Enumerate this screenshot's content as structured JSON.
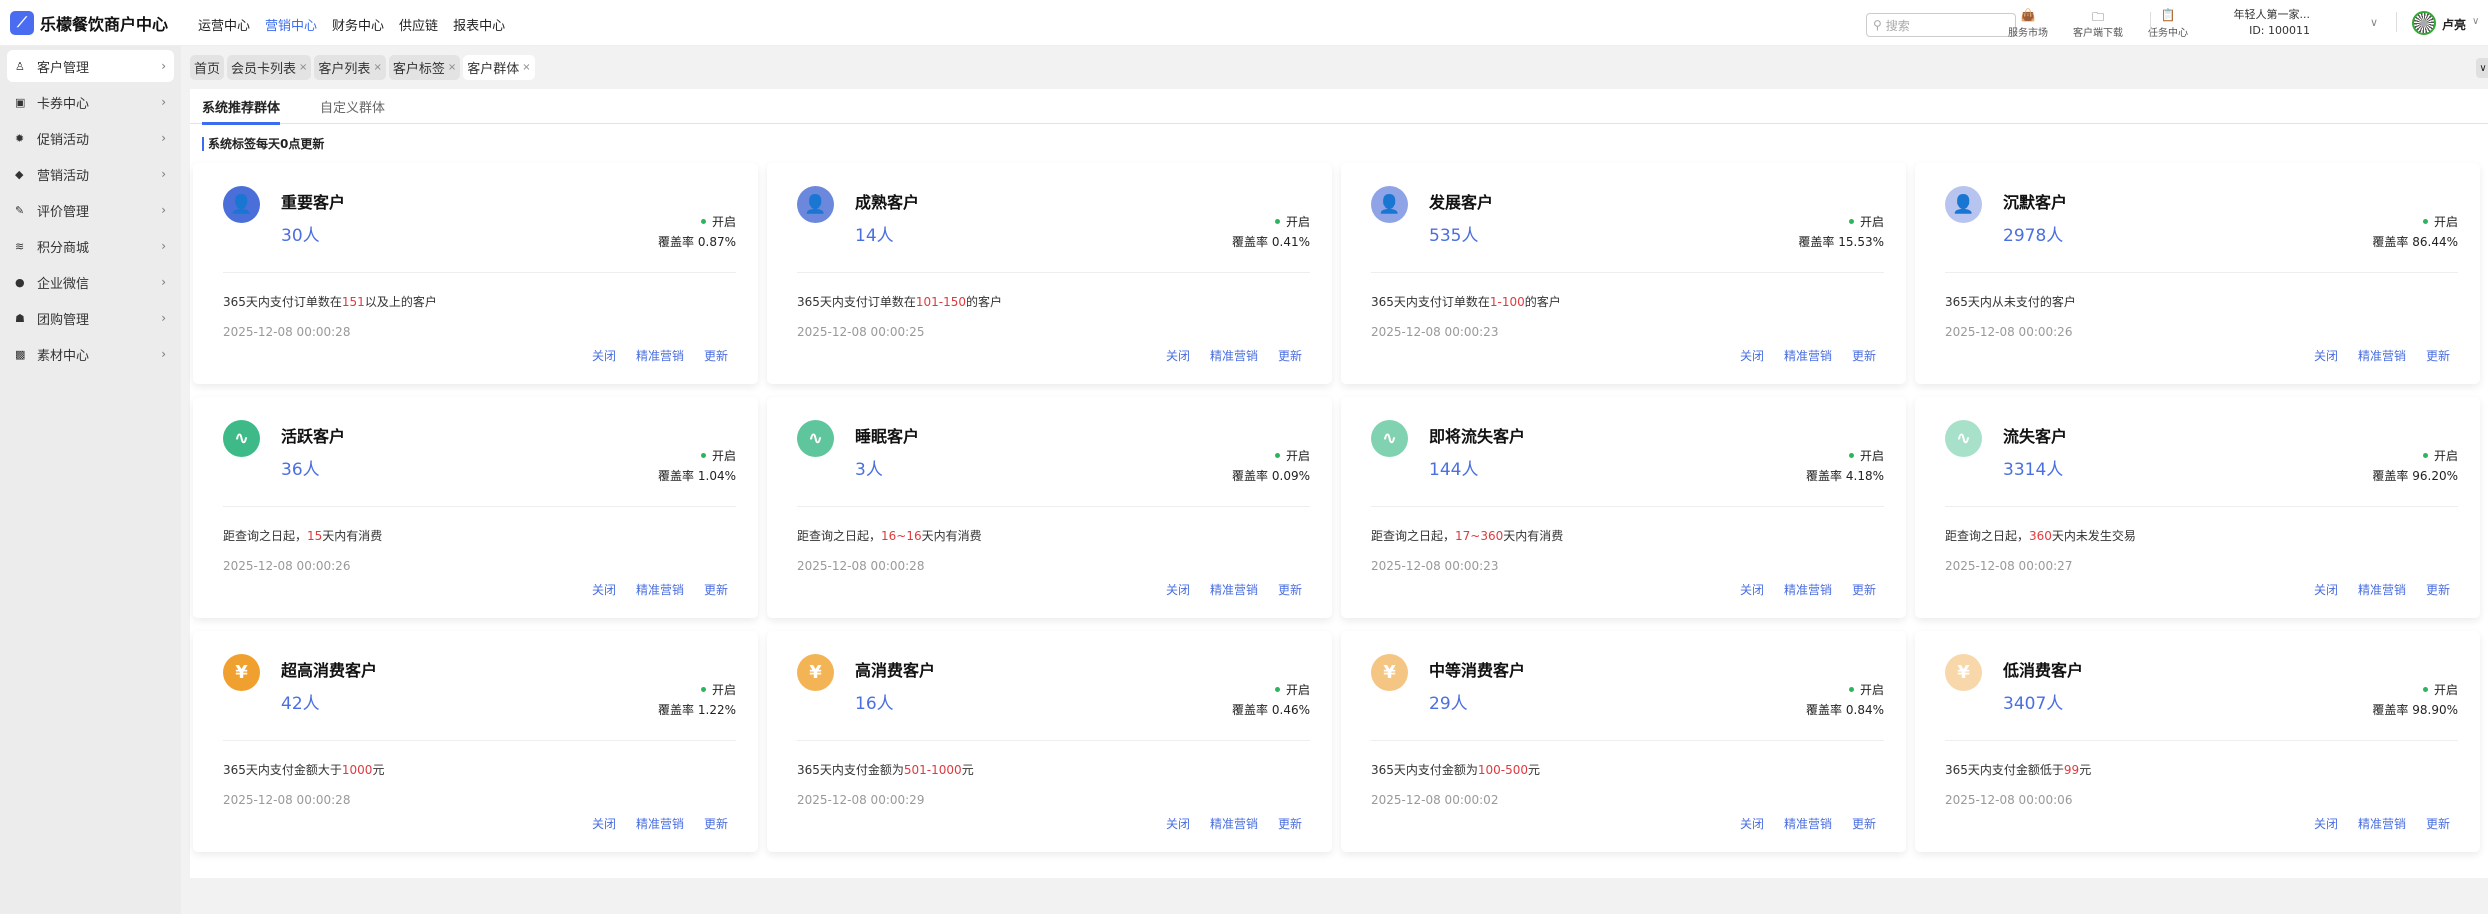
{
  "app": {
    "title": "乐檬餐饮商户中心",
    "logo_glyph": "乐"
  },
  "topnav": [
    "运营中心",
    "营销中心",
    "财务中心",
    "供应链",
    "报表中心"
  ],
  "topnav_active": 1,
  "search": {
    "placeholder": "搜索"
  },
  "tools": [
    {
      "label": "服务市场",
      "icon": "shopping-bag-icon",
      "glyph": "👜"
    },
    {
      "label": "客户端下载",
      "icon": "folder-download-icon",
      "glyph": "🗀"
    },
    {
      "label": "任务中心",
      "icon": "clipboard-check-icon",
      "glyph": "📋"
    }
  ],
  "shop": {
    "name": "年轻人第一家...",
    "id": "ID: 100011"
  },
  "user": {
    "name": "卢亮"
  },
  "sidebar": [
    {
      "label": "客户管理",
      "icon": "user-icon",
      "glyph": "♙"
    },
    {
      "label": "卡券中心",
      "icon": "coupon-icon",
      "glyph": "▣"
    },
    {
      "label": "促销活动",
      "icon": "discount-badge-icon",
      "glyph": "✹"
    },
    {
      "label": "营销活动",
      "icon": "tag-icon",
      "glyph": "◆"
    },
    {
      "label": "评价管理",
      "icon": "edit-icon",
      "glyph": "✎"
    },
    {
      "label": "积分商城",
      "icon": "coins-icon",
      "glyph": "≋"
    },
    {
      "label": "企业微信",
      "icon": "chat-icon",
      "glyph": "●"
    },
    {
      "label": "团购管理",
      "icon": "store-icon",
      "glyph": "☗"
    },
    {
      "label": "素材中心",
      "icon": "image-icon",
      "glyph": "▩"
    }
  ],
  "tabs": [
    {
      "label": "首页",
      "closable": false
    },
    {
      "label": "会员卡列表",
      "closable": true
    },
    {
      "label": "客户列表",
      "closable": true
    },
    {
      "label": "客户标签",
      "closable": true
    },
    {
      "label": "客户群体",
      "closable": true,
      "active": true
    }
  ],
  "close_glyph": "×",
  "subtabs": [
    "系统推荐群体",
    "自定义群体"
  ],
  "notice": "系统标签每天0点更新",
  "labels": {
    "status": "开启",
    "rate_prefix": "覆盖率",
    "close": "关闭",
    "marketing": "精准营销",
    "update": "更新"
  },
  "cards": [
    {
      "name": "重要客户",
      "count": "30人",
      "rate": "0.87%",
      "desc_pre": "365天内支付订单数在",
      "desc_hl": "151",
      "desc_post": "以及上的客户",
      "date": "2025-12-08 00:00:28",
      "color": "#4a6fd8",
      "icon": "user-group-icon",
      "glyph": "👤"
    },
    {
      "name": "成熟客户",
      "count": "14人",
      "rate": "0.41%",
      "desc_pre": "365天内支付订单数在",
      "desc_hl": "101-150",
      "desc_post": "的客户",
      "date": "2025-12-08 00:00:25",
      "color": "#6b88dd",
      "icon": "user-group-icon",
      "glyph": "👤"
    },
    {
      "name": "发展客户",
      "count": "535人",
      "rate": "15.53%",
      "desc_pre": "365天内支付订单数在",
      "desc_hl": "1-100",
      "desc_post": "的客户",
      "date": "2025-12-08 00:00:23",
      "color": "#8fa4e6",
      "icon": "user-group-icon",
      "glyph": "👤"
    },
    {
      "name": "沉默客户",
      "count": "2978人",
      "rate": "86.44%",
      "desc_pre": "365天内从未支付的客户",
      "desc_hl": "",
      "desc_post": "",
      "date": "2025-12-08 00:00:26",
      "color": "#b7c4ef",
      "icon": "user-group-icon",
      "glyph": "👤"
    },
    {
      "name": "活跃客户",
      "count": "36人",
      "rate": "1.04%",
      "desc_pre": "距查询之日起，",
      "desc_hl": "15",
      "desc_post": "天内有消费",
      "date": "2025-12-08 00:00:26",
      "color": "#3dba87",
      "icon": "activity-icon",
      "glyph": "∿"
    },
    {
      "name": "睡眠客户",
      "count": "3人",
      "rate": "0.09%",
      "desc_pre": "距查询之日起，",
      "desc_hl": "16~16",
      "desc_post": "天内有消费",
      "date": "2025-12-08 00:00:28",
      "color": "#5ec59c",
      "icon": "activity-icon",
      "glyph": "∿"
    },
    {
      "name": "即将流失客户",
      "count": "144人",
      "rate": "4.18%",
      "desc_pre": "距查询之日起，",
      "desc_hl": "17~360",
      "desc_post": "天内有消费",
      "date": "2025-12-08 00:00:23",
      "color": "#80d2b1",
      "icon": "activity-icon",
      "glyph": "∿"
    },
    {
      "name": "流失客户",
      "count": "3314人",
      "rate": "96.20%",
      "desc_pre": "距查询之日起，",
      "desc_hl": "360",
      "desc_post": "天内未发生交易",
      "date": "2025-12-08 00:00:27",
      "color": "#a8e1c9",
      "icon": "activity-icon",
      "glyph": "∿"
    },
    {
      "name": "超高消费客户",
      "count": "42人",
      "rate": "1.22%",
      "desc_pre": "365天内支付金额大于",
      "desc_hl": "1000",
      "desc_post": "元",
      "date": "2025-12-08 00:00:28",
      "color": "#f0a02e",
      "icon": "yuan-icon",
      "glyph": "¥"
    },
    {
      "name": "高消费客户",
      "count": "16人",
      "rate": "0.46%",
      "desc_pre": "365天内支付金额为",
      "desc_hl": "501-1000",
      "desc_post": "元",
      "date": "2025-12-08 00:00:29",
      "color": "#f3b456",
      "icon": "yuan-icon",
      "glyph": "¥"
    },
    {
      "name": "中等消费客户",
      "count": "29人",
      "rate": "0.84%",
      "desc_pre": "365天内支付金额为",
      "desc_hl": "100-500",
      "desc_post": "元",
      "date": "2025-12-08 00:00:02",
      "color": "#f5c583",
      "icon": "yuan-icon",
      "glyph": "¥"
    },
    {
      "name": "低消费客户",
      "count": "3407人",
      "rate": "98.90%",
      "desc_pre": "365天内支付金额低于",
      "desc_hl": "99",
      "desc_post": "元",
      "date": "2025-12-08 00:00:06",
      "color": "#f8d8ab",
      "icon": "yuan-icon",
      "glyph": "¥"
    }
  ]
}
